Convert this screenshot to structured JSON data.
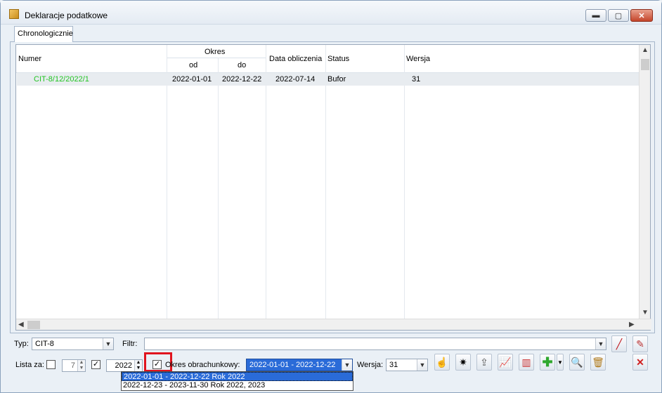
{
  "window": {
    "title": "Deklaracje podatkowe"
  },
  "tab": {
    "label": "Chronologicznie"
  },
  "grid": {
    "headers": {
      "numer": "Numer",
      "okres": "Okres",
      "od": "od",
      "do": "do",
      "data_obliczenia": "Data obliczenia",
      "status": "Status",
      "wersja": "Wersja"
    },
    "rows": [
      {
        "numer": "CIT-8/12/2022/1",
        "od": "2022-01-01",
        "do": "2022-12-22",
        "data_obliczenia": "2022-07-14",
        "status": "Bufor",
        "wersja": "31"
      }
    ]
  },
  "filters": {
    "typ_label": "Typ:",
    "typ_value": "CIT-8",
    "filtr_label": "Filtr:",
    "filtr_value": "",
    "lista_za_label": "Lista za:",
    "lista_month": "7",
    "lista_year": "2022",
    "okres_label": "Okres obrachunkowy:",
    "okres_value": "2022-01-01 - 2022-12-22",
    "wersja_label": "Wersja:",
    "wersja_value": "31"
  },
  "dropdown": {
    "options": [
      "2022-01-01 - 2022-12-22  Rok 2022",
      "2022-12-23 - 2023-11-30  Rok 2022, 2023"
    ]
  },
  "colors": {
    "accent": "#2a6bd8",
    "number_green": "#22c422",
    "highlight_red": "#e0141e"
  }
}
